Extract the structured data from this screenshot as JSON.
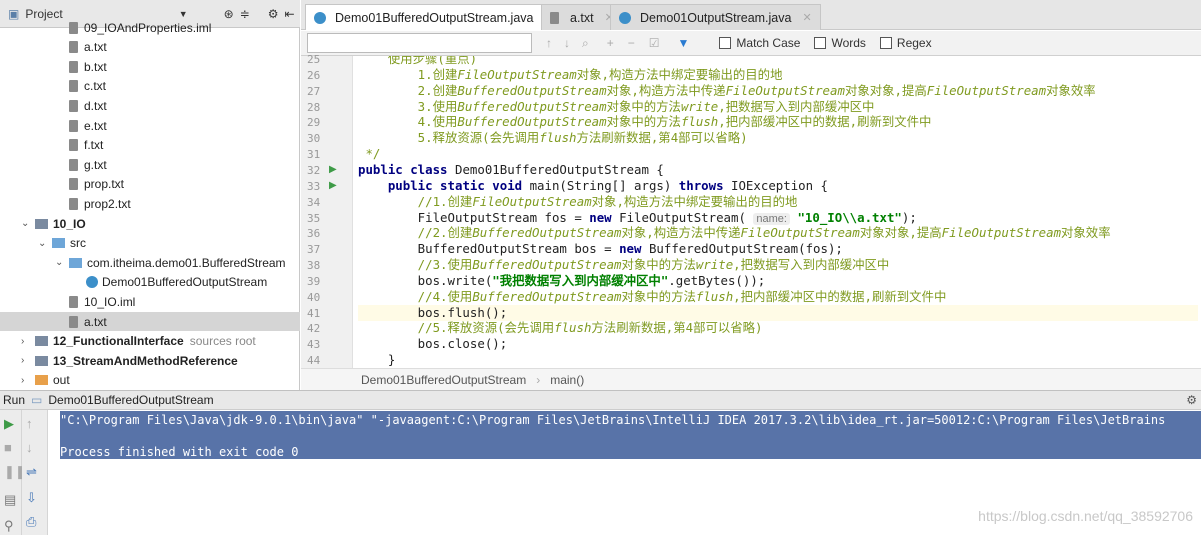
{
  "project_panel": {
    "title": "Project",
    "tree": [
      {
        "label": "09_IOAndProperties.iml",
        "indent": 3,
        "icon": "iml-file-icon"
      },
      {
        "label": "a.txt",
        "indent": 3,
        "icon": "text-file-icon"
      },
      {
        "label": "b.txt",
        "indent": 3,
        "icon": "text-file-icon"
      },
      {
        "label": "c.txt",
        "indent": 3,
        "icon": "text-file-icon"
      },
      {
        "label": "d.txt",
        "indent": 3,
        "icon": "text-file-icon"
      },
      {
        "label": "e.txt",
        "indent": 3,
        "icon": "text-file-icon"
      },
      {
        "label": "f.txt",
        "indent": 3,
        "icon": "text-file-icon"
      },
      {
        "label": "g.txt",
        "indent": 3,
        "icon": "text-file-icon"
      },
      {
        "label": "prop.txt",
        "indent": 3,
        "icon": "text-file-icon"
      },
      {
        "label": "prop2.txt",
        "indent": 3,
        "icon": "text-file-icon"
      },
      {
        "label": "10_IO",
        "indent": 1,
        "icon": "module-icon",
        "arrow": "expanded",
        "bold": true
      },
      {
        "label": "src",
        "indent": 2,
        "icon": "source-folder-icon",
        "arrow": "expanded"
      },
      {
        "label": "com.itheima.demo01.BufferedStream",
        "indent": 3,
        "icon": "package-icon",
        "arrow": "expanded"
      },
      {
        "label": "Demo01BufferedOutputStream",
        "indent": 4,
        "icon": "java-class-icon"
      },
      {
        "label": "10_IO.iml",
        "indent": 3,
        "icon": "iml-file-icon"
      },
      {
        "label": "a.txt",
        "indent": 3,
        "icon": "text-file-icon",
        "selected": true
      },
      {
        "label": "12_FunctionalInterface",
        "suffix": "sources root",
        "indent": 1,
        "icon": "module-icon",
        "arrow": "collapsed",
        "bold": true
      },
      {
        "label": "13_StreamAndMethodReference",
        "indent": 1,
        "icon": "module-icon",
        "arrow": "collapsed",
        "bold": true
      },
      {
        "label": "out",
        "indent": 1,
        "icon": "folder-icon",
        "arrow": "collapsed"
      }
    ]
  },
  "tabs": [
    {
      "label": "Demo01BufferedOutputStream.java",
      "active": true
    },
    {
      "label": "a.txt"
    },
    {
      "label": "Demo01OutputStream.java"
    }
  ],
  "search": {
    "value": "",
    "options": [
      "Match Case",
      "Words",
      "Regex"
    ]
  },
  "editor": {
    "lines": [
      {
        "n": "25",
        "segs": [
          [
            "cmc",
            "    使用步骤(重点)"
          ]
        ]
      },
      {
        "n": "26",
        "segs": [
          [
            "cmc",
            "        1.创建"
          ],
          [
            "cm",
            "FileOutputStream"
          ],
          [
            "cmc",
            "对象,构造方法中绑定要输出的目的地"
          ]
        ]
      },
      {
        "n": "27",
        "segs": [
          [
            "cmc",
            "        2.创建"
          ],
          [
            "cm",
            "BufferedOutputStream"
          ],
          [
            "cmc",
            "对象,构造方法中传递"
          ],
          [
            "cm",
            "FileOutputStream"
          ],
          [
            "cmc",
            "对象对象,提高"
          ],
          [
            "cm",
            "FileOutputStream"
          ],
          [
            "cmc",
            "对象效率"
          ]
        ]
      },
      {
        "n": "28",
        "segs": [
          [
            "cmc",
            "        3.使用"
          ],
          [
            "cm",
            "BufferedOutputStream"
          ],
          [
            "cmc",
            "对象中的方法"
          ],
          [
            "cm",
            "write"
          ],
          [
            "cmc",
            ",把数据写入到内部缓冲区中"
          ]
        ]
      },
      {
        "n": "29",
        "segs": [
          [
            "cmc",
            "        4.使用"
          ],
          [
            "cm",
            "BufferedOutputStream"
          ],
          [
            "cmc",
            "对象中的方法"
          ],
          [
            "cm",
            "flush"
          ],
          [
            "cmc",
            ",把内部缓冲区中的数据,刷新到文件中"
          ]
        ]
      },
      {
        "n": "30",
        "segs": [
          [
            "cmc",
            "        5.释放资源(会先调用"
          ],
          [
            "cm",
            "flush"
          ],
          [
            "cmc",
            "方法刷新数据,第4部可以省略)"
          ]
        ]
      },
      {
        "n": "31",
        "segs": [
          [
            "cmc",
            " */"
          ]
        ]
      },
      {
        "n": "32",
        "run": true,
        "segs": [
          [
            "kw",
            "public class "
          ],
          [
            "",
            "Demo01BufferedOutputStream {"
          ]
        ]
      },
      {
        "n": "33",
        "run": true,
        "segs": [
          [
            "",
            "    "
          ],
          [
            "kw",
            "public static void "
          ],
          [
            "",
            "main(String[] args) "
          ],
          [
            "kw",
            "throws "
          ],
          [
            "",
            "IOException {"
          ]
        ]
      },
      {
        "n": "34",
        "segs": [
          [
            "cmc",
            "        //1.创建"
          ],
          [
            "cm",
            "FileOutputStream"
          ],
          [
            "cmc",
            "对象,构造方法中绑定要输出的目的地"
          ]
        ]
      },
      {
        "n": "35",
        "segs": [
          [
            "",
            "        FileOutputStream fos = "
          ],
          [
            "kw",
            "new "
          ],
          [
            "",
            "FileOutputStream( "
          ],
          [
            "hint",
            "name:"
          ],
          [
            "",
            " "
          ],
          [
            "st",
            "\"10_IO\\\\a.txt\""
          ],
          [
            "",
            ");"
          ]
        ]
      },
      {
        "n": "36",
        "segs": [
          [
            "cmc",
            "        //2.创建"
          ],
          [
            "cm",
            "BufferedOutputStream"
          ],
          [
            "cmc",
            "对象,构造方法中传递"
          ],
          [
            "cm",
            "FileOutputStream"
          ],
          [
            "cmc",
            "对象对象,提高"
          ],
          [
            "cm",
            "FileOutputStream"
          ],
          [
            "cmc",
            "对象效率"
          ]
        ]
      },
      {
        "n": "37",
        "segs": [
          [
            "",
            "        BufferedOutputStream bos = "
          ],
          [
            "kw",
            "new "
          ],
          [
            "",
            "BufferedOutputStream(fos);"
          ]
        ]
      },
      {
        "n": "38",
        "segs": [
          [
            "cmc",
            "        //3.使用"
          ],
          [
            "cm",
            "BufferedOutputStream"
          ],
          [
            "cmc",
            "对象中的方法"
          ],
          [
            "cm",
            "write"
          ],
          [
            "cmc",
            ",把数据写入到内部缓冲区中"
          ]
        ]
      },
      {
        "n": "39",
        "segs": [
          [
            "",
            "        bos.write("
          ],
          [
            "st",
            "\"我把数据写入到内部缓冲区中\""
          ],
          [
            "",
            ".getBytes());"
          ]
        ]
      },
      {
        "n": "40",
        "segs": [
          [
            "cmc",
            "        //4.使用"
          ],
          [
            "cm",
            "BufferedOutputStream"
          ],
          [
            "cmc",
            "对象中的方法"
          ],
          [
            "cm",
            "flush"
          ],
          [
            "cmc",
            ",把内部缓冲区中的数据,刷新到文件中"
          ]
        ]
      },
      {
        "n": "41",
        "hl": true,
        "segs": [
          [
            "",
            "        bos.flush();"
          ]
        ]
      },
      {
        "n": "42",
        "segs": [
          [
            "cmc",
            "        //5.释放资源(会先调用"
          ],
          [
            "cm",
            "flush"
          ],
          [
            "cmc",
            "方法刷新数据,第4部可以省略)"
          ]
        ]
      },
      {
        "n": "43",
        "segs": [
          [
            "",
            "        bos.close();"
          ]
        ]
      },
      {
        "n": "44",
        "segs": [
          [
            "",
            "    }"
          ]
        ]
      }
    ]
  },
  "breadcrumb": [
    "Demo01BufferedOutputStream",
    "main()"
  ],
  "run": {
    "label": "Run",
    "config": "Demo01BufferedOutputStream",
    "output": [
      "\"C:\\Program Files\\Java\\jdk-9.0.1\\bin\\java\" \"-javaagent:C:\\Program Files\\JetBrains\\IntelliJ IDEA 2017.3.2\\lib\\idea_rt.jar=50012:C:\\Program Files\\JetBrains",
      "",
      "Process finished with exit code 0"
    ]
  },
  "watermark": "https://blog.csdn.net/qq_38592706",
  "colors": {
    "selection": "#5873a8",
    "keyword": "#000080",
    "comment": "#7f9a1f",
    "string": "#008000"
  }
}
